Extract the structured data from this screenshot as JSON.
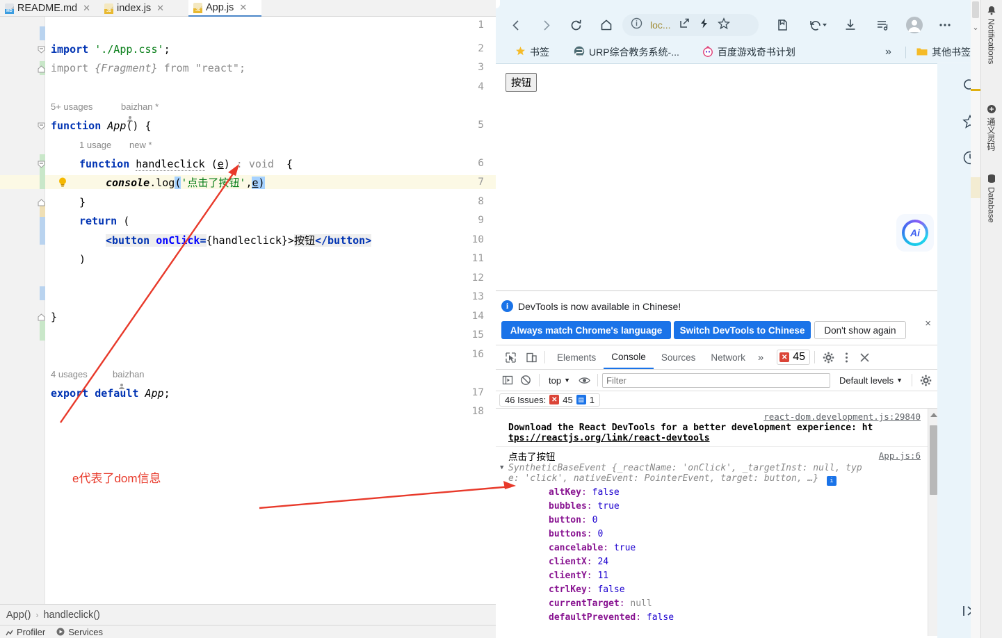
{
  "ide": {
    "tabs": [
      {
        "label": "README.md",
        "icon": "markdown-file-icon",
        "active": false
      },
      {
        "label": "index.js",
        "icon": "javascript-file-icon",
        "active": false
      },
      {
        "label": "App.js",
        "icon": "javascript-file-icon",
        "active": true
      }
    ],
    "line_numbers": [
      "1",
      "2",
      "3",
      "4",
      "5",
      "6",
      "7",
      "8",
      "9",
      "10",
      "11",
      "12",
      "13",
      "14",
      "15",
      "16",
      "17",
      "18"
    ],
    "code": {
      "l2": "import './App.css';",
      "l3": "import {Fragment} from \"react\";",
      "hint_usages_app": "5+ usages",
      "hint_author_app": "baizhan *",
      "l5": "function App() {",
      "hint_usages_handle": "1 usage",
      "hint_new_handle": "new *",
      "l6": "function handleclick (e) : void  {",
      "l7": "console.log('点击了按钮',e)",
      "l8": "}",
      "l9": "return (",
      "l10": "<button onClick={handleclick}>按钮</button>",
      "l11": ")",
      "l14": "}",
      "hint_usages_export": "4 usages",
      "hint_author_export": "baizhan",
      "l17": "export default App;"
    },
    "annotation": "e代表了dom信息",
    "breadcrumb": {
      "first": "App()",
      "sep": "›",
      "second": "handleclick()"
    },
    "status": {
      "profiler": "Profiler",
      "services": "Services"
    }
  },
  "browser": {
    "nav": {
      "back": "back-arrow",
      "forward": "forward-arrow",
      "reload": "reload",
      "home": "home",
      "omnibox_text": "loc...",
      "info": "site-info",
      "split": "split-screen",
      "performance": "performance",
      "favorite": "favorite",
      "collections": "collections",
      "history": "history-back",
      "downloads": "downloads",
      "playlist": "playlist",
      "profile": "profile",
      "more": "more"
    },
    "bookmarks": [
      {
        "label": "书签",
        "icon": "star-icon"
      },
      {
        "label": "URP综合教务系统-...",
        "icon": "site-icon"
      },
      {
        "label": "百度游戏奇书计划",
        "icon": "site-icon"
      }
    ],
    "bookmarks_overflow": "»",
    "other_bookmarks": "其他书签",
    "page": {
      "button_label": "按钮"
    },
    "ai_badge": "Ai",
    "sidebar_icons": [
      "search-icon",
      "favorite-icon",
      "history-icon"
    ]
  },
  "devtools": {
    "notice": {
      "text": "DevTools is now available in Chinese!",
      "btn_always": "Always match Chrome's language",
      "btn_switch": "Switch DevTools to Chinese",
      "btn_dismiss": "Don't show again",
      "close": "×"
    },
    "tabs": [
      {
        "label": "Elements",
        "active": false
      },
      {
        "label": "Console",
        "active": true
      },
      {
        "label": "Sources",
        "active": false
      },
      {
        "label": "Network",
        "active": false
      }
    ],
    "tabs_overflow": "»",
    "error_count": "45",
    "filterbar": {
      "context": "top",
      "filter_placeholder": "Filter",
      "levels": "Default levels"
    },
    "issues": {
      "prefix": "46 Issues:",
      "errors": "45",
      "messages": "1"
    },
    "console_entries": [
      {
        "source": "react-dom.development.js:29840",
        "line1": "Download the React DevTools for a better development experience: ht",
        "line2": "tps://reactjs.org/link/react-devtools"
      },
      {
        "source": "App.js:6",
        "log": "点击了按钮",
        "object_head_1": "SyntheticBaseEvent {_reactName: 'onClick', _targetInst: null, typ",
        "object_head_2": "e: 'click', nativeEvent: PointerEvent, target: button, …}",
        "properties": [
          {
            "key": "altKey",
            "value": "false",
            "vtype": "bool"
          },
          {
            "key": "bubbles",
            "value": "true",
            "vtype": "bool"
          },
          {
            "key": "button",
            "value": "0",
            "vtype": "num"
          },
          {
            "key": "buttons",
            "value": "0",
            "vtype": "num"
          },
          {
            "key": "cancelable",
            "value": "true",
            "vtype": "bool"
          },
          {
            "key": "clientX",
            "value": "24",
            "vtype": "num"
          },
          {
            "key": "clientY",
            "value": "11",
            "vtype": "num"
          },
          {
            "key": "ctrlKey",
            "value": "false",
            "vtype": "bool"
          },
          {
            "key": "currentTarget",
            "value": "null",
            "vtype": "null"
          },
          {
            "key": "defaultPrevented",
            "value": "false",
            "vtype": "bool"
          }
        ]
      }
    ]
  },
  "right_strip": {
    "labels": [
      "Notifications",
      "通义灵码",
      "Database"
    ]
  },
  "colors": {
    "accent_blue": "#1a73e8",
    "error_red": "#db4437",
    "annotation_red": "#e8392a",
    "edge_bg": "#eaf4fa"
  }
}
